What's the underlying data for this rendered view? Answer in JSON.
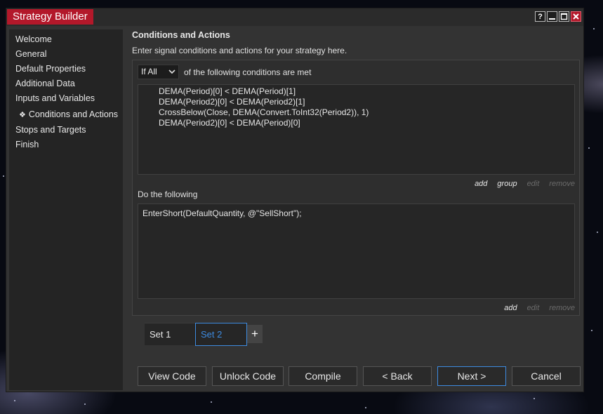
{
  "window": {
    "title": "Strategy Builder",
    "controls": {
      "help": "?"
    }
  },
  "sidebar": {
    "items": [
      {
        "label": "Welcome"
      },
      {
        "label": "General"
      },
      {
        "label": "Default Properties"
      },
      {
        "label": "Additional Data"
      },
      {
        "label": "Inputs and Variables"
      },
      {
        "label": "Conditions and Actions",
        "active": true
      },
      {
        "label": "Stops and Targets"
      },
      {
        "label": "Finish"
      }
    ]
  },
  "main": {
    "heading": "Conditions and Actions",
    "description": "Enter signal conditions and actions for your strategy here.",
    "condition_mode": {
      "selected": "If All",
      "suffix": "of the following conditions are met"
    },
    "conditions": [
      "DEMA(Period)[0] < DEMA(Period)[1]",
      "DEMA(Period2)[0] < DEMA(Period2)[1]",
      "CrossBelow(Close, DEMA(Convert.ToInt32(Period2)), 1)",
      "DEMA(Period2)[0] < DEMA(Period)[0]"
    ],
    "condition_links": {
      "add": "add",
      "group": "group",
      "edit": "edit",
      "remove": "remove"
    },
    "actions_label": "Do the following",
    "actions": [
      "EnterShort(DefaultQuantity, @\"SellShort\");"
    ],
    "action_links": {
      "add": "add",
      "edit": "edit",
      "remove": "remove"
    },
    "sets": [
      {
        "label": "Set 1"
      },
      {
        "label": "Set 2",
        "selected": true
      }
    ],
    "add_set": "+"
  },
  "footer": {
    "view_code": "View Code",
    "unlock_code": "Unlock Code",
    "compile": "Compile",
    "back": "< Back",
    "next": "Next >",
    "cancel": "Cancel"
  },
  "colors": {
    "accent": "#b3182a",
    "selection": "#3d8be0"
  }
}
